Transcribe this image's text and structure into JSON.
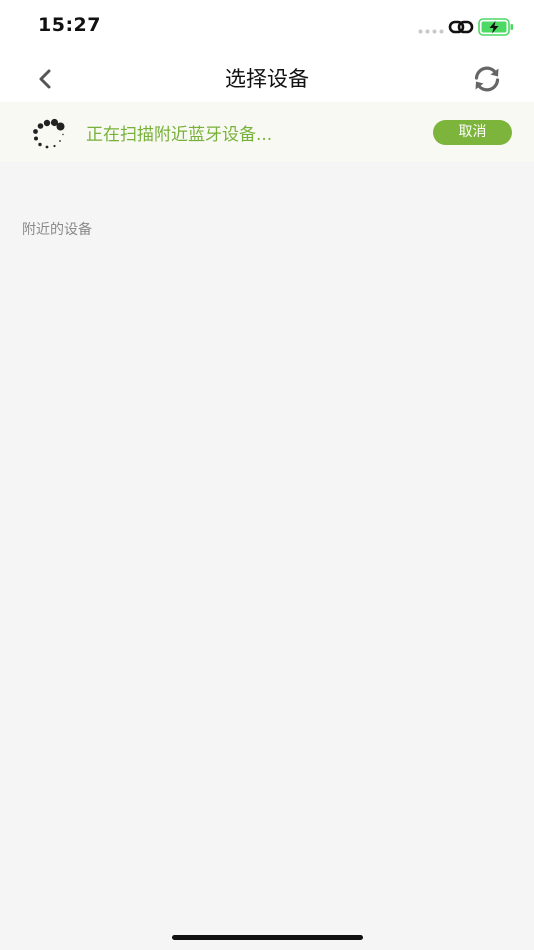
{
  "status_bar": {
    "time": "15:27",
    "icons": [
      "signal-dots-icon",
      "link-icon",
      "battery-charging-icon"
    ],
    "battery_color": "#4cd964"
  },
  "nav": {
    "title": "选择设备",
    "back_icon": "chevron-left-icon",
    "refresh_icon": "refresh-icon"
  },
  "scan_banner": {
    "message": "正在扫描附近蓝牙设备...",
    "cancel_label": "取消",
    "spinner_icon": "loading-spinner-icon",
    "accent_color": "#7db43c"
  },
  "devices": {
    "section_label": "附近的设备",
    "items": []
  }
}
